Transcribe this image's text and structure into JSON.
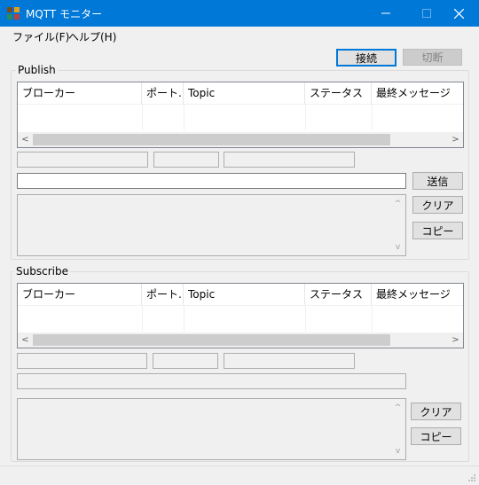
{
  "window": {
    "title": "MQTT モニター",
    "icon": "mqtt-app-icon",
    "controls": {
      "minimize": "–",
      "maximize": "□",
      "close": "✕"
    }
  },
  "menu": {
    "file": "ファイル(F)",
    "help": "ヘルプ(H)"
  },
  "toolbar": {
    "connect_label": "接続",
    "disconnect_label": "切断"
  },
  "publish": {
    "group_label": "Publish",
    "columns": [
      "ブローカー",
      "ポート...",
      "Topic",
      "ステータス",
      "最終メッセージ"
    ],
    "message_input": "",
    "send_label": "送信",
    "clear_label": "クリア",
    "copy_label": "コピー"
  },
  "subscribe": {
    "group_label": "Subscribe",
    "columns": [
      "ブローカー",
      "ポート...",
      "Topic",
      "ステータス",
      "最終メッセージ"
    ],
    "clear_label": "クリア",
    "copy_label": "コピー"
  },
  "scroll": {
    "left": "<",
    "right": ">",
    "up": "^",
    "down": "v"
  },
  "colors": {
    "titlebar": "#0078d7",
    "accent": "#0078d7",
    "window_bg": "#f0f0f0"
  }
}
